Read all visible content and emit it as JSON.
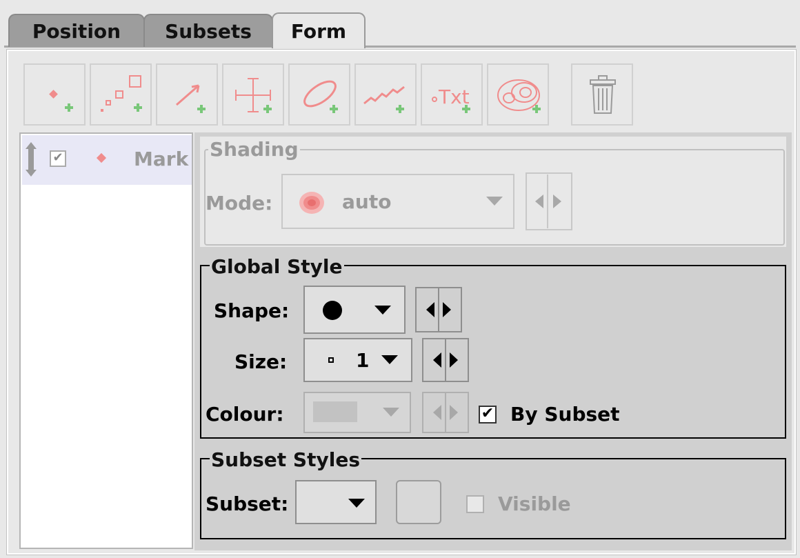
{
  "tabs": [
    "Position",
    "Subsets",
    "Form"
  ],
  "active_tab": "Form",
  "toolbar": {
    "buttons": [
      "add-mark-layer",
      "add-size-layer",
      "add-vector-layer",
      "add-error-layer",
      "add-ellipse-layer",
      "add-line-layer",
      "add-text-layer",
      "add-contour-layer"
    ],
    "delete": "trash-icon"
  },
  "layers": [
    {
      "label": "Mark",
      "checked": true
    }
  ],
  "shading": {
    "legend": "Shading",
    "mode_label": "Mode:",
    "mode_value": "auto"
  },
  "global_style": {
    "legend": "Global Style",
    "shape_label": "Shape:",
    "shape_value": "filled-circle",
    "size_label": "Size:",
    "size_value": "1",
    "colour_label": "Colour:",
    "by_subset_label": "By Subset",
    "by_subset_checked": true
  },
  "subset_styles": {
    "legend": "Subset Styles",
    "subset_label": "Subset:",
    "visible_label": "Visible",
    "visible_checked": false
  },
  "colors": {
    "marker_pink": "#f08c8c",
    "plus_green": "#79c779",
    "disabled_text": "#9a9a9a"
  }
}
